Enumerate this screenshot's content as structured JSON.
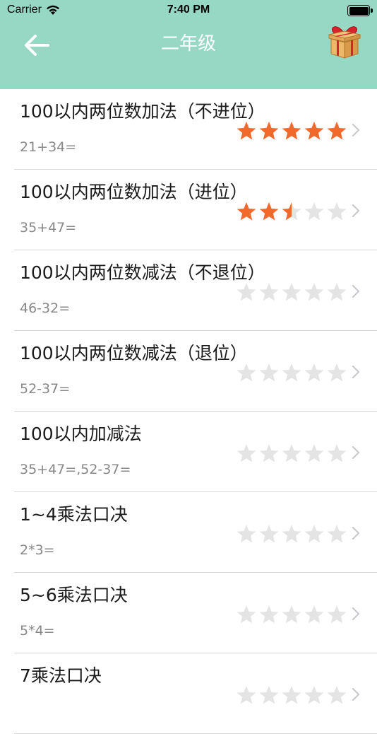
{
  "status": {
    "carrier": "Carrier",
    "time": "7:40 PM"
  },
  "nav": {
    "title": "二年级",
    "back_icon": "arrow-left-icon",
    "gift_icon": "gift-box-icon"
  },
  "colors": {
    "header": "#97d8c4",
    "star_on": "#f2692b",
    "star_off": "#e4e4e4"
  },
  "max_stars": 5,
  "lessons": [
    {
      "name": "100以内两位数加法（不进位）",
      "sample": "21+34=",
      "rating": 5
    },
    {
      "name": "100以内两位数加法（进位）",
      "sample": "35+47=",
      "rating": 2.5
    },
    {
      "name": "100以内两位数减法（不退位）",
      "sample": "46-32=",
      "rating": 0
    },
    {
      "name": "100以内两位数减法（退位）",
      "sample": "52-37=",
      "rating": 0
    },
    {
      "name": "100以内加减法",
      "sample": "35+47=,52-37=",
      "rating": 0
    },
    {
      "name": "1~4乘法口决",
      "sample": "2*3=",
      "rating": 0
    },
    {
      "name": "5~6乘法口决",
      "sample": "5*4=",
      "rating": 0
    },
    {
      "name": "7乘法口决",
      "sample": "",
      "rating": 0
    }
  ]
}
